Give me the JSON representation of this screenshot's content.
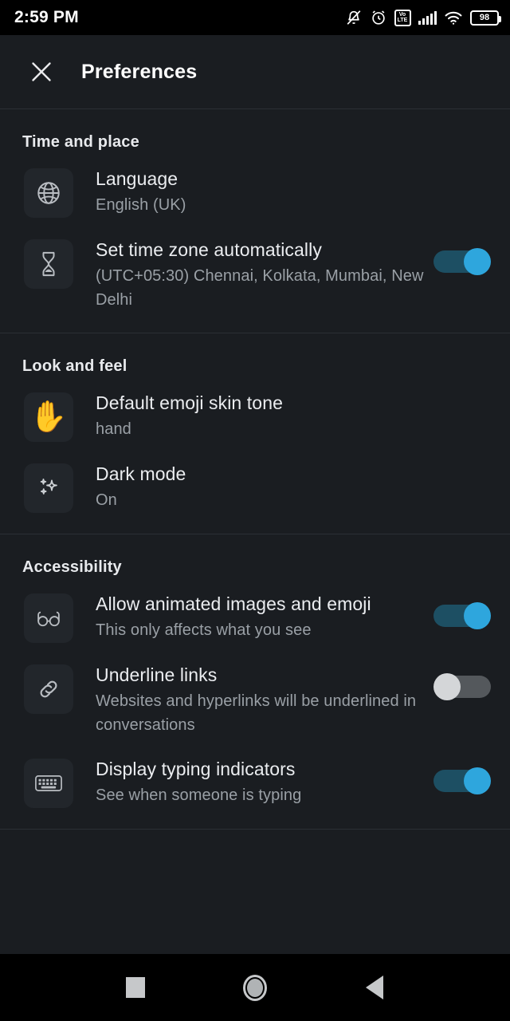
{
  "status_bar": {
    "time": "2:59 PM",
    "icons": [
      "bell-mute-icon",
      "alarm-clock-icon",
      "volte-icon",
      "signal-bars-icon",
      "wifi-icon",
      "battery-icon"
    ],
    "volte_top": "Vo",
    "volte_bottom": "LTE",
    "battery_percent": "98"
  },
  "app_bar": {
    "close_icon": "close-icon",
    "title": "Preferences"
  },
  "colors": {
    "background": "#1a1d21",
    "tile": "#22262b",
    "toggle_on_track": "#1d4f63",
    "toggle_on_thumb": "#2ea6dd",
    "toggle_off_track": "#54585c",
    "toggle_off_thumb": "#d4d6d8",
    "title_text": "#ebedf0",
    "subtitle_text": "#9aa0a6",
    "divider": "#2b2f35"
  },
  "sections": [
    {
      "title": "Time and place",
      "rows": [
        {
          "icon": "globe-icon",
          "title": "Language",
          "subtitle": "English (UK)",
          "control": "none"
        },
        {
          "icon": "hourglass-icon",
          "title": "Set time zone automatically",
          "subtitle": "(UTC+05:30) Chennai, Kolkata, Mumbai, New Delhi",
          "control": "toggle",
          "toggle_state": "on"
        }
      ]
    },
    {
      "title": "Look and feel",
      "rows": [
        {
          "icon": "raised-hand-emoji",
          "emoji": "✋",
          "title": "Default emoji skin tone",
          "subtitle": "hand",
          "control": "none"
        },
        {
          "icon": "sparkles-icon",
          "title": "Dark mode",
          "subtitle": "On",
          "control": "none"
        }
      ]
    },
    {
      "title": "Accessibility",
      "rows": [
        {
          "icon": "glasses-icon",
          "title": "Allow animated images and emoji",
          "subtitle": "This only affects what you see",
          "control": "toggle",
          "toggle_state": "on"
        },
        {
          "icon": "link-icon",
          "title": "Underline links",
          "subtitle": "Websites and hyperlinks will be underlined in conversations",
          "control": "toggle",
          "toggle_state": "off"
        },
        {
          "icon": "keyboard-icon",
          "title": "Display typing indicators",
          "subtitle": "See when someone is typing",
          "control": "toggle",
          "toggle_state": "on"
        }
      ]
    }
  ],
  "nav_bar": {
    "recents": "recents-square-icon",
    "home": "home-circle-icon",
    "back": "back-triangle-icon"
  }
}
